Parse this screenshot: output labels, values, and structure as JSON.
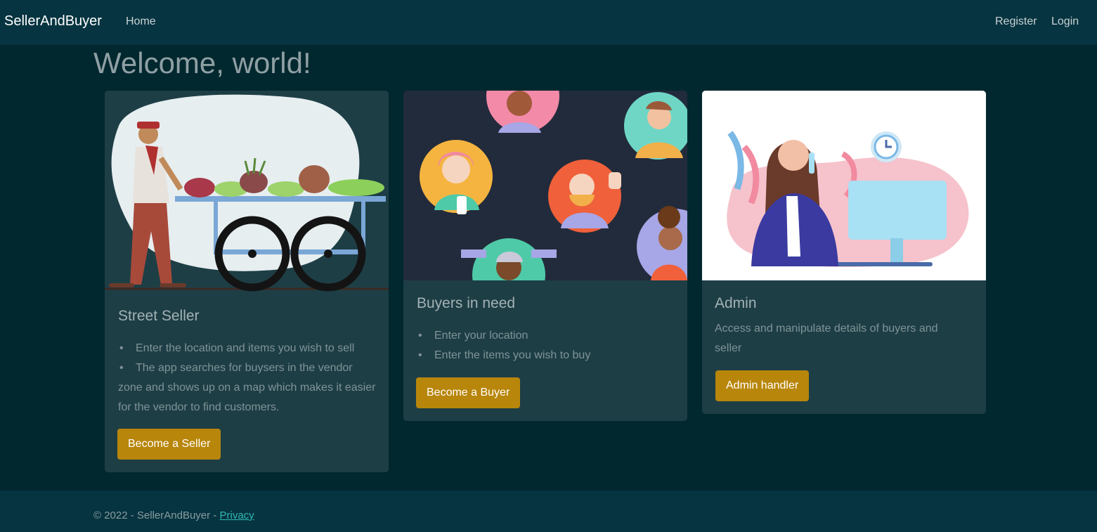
{
  "nav": {
    "brand": "SellerAndBuyer",
    "home": "Home",
    "register": "Register",
    "login": "Login"
  },
  "page": {
    "title": "Welcome, world!"
  },
  "cards": [
    {
      "title": "Street Seller",
      "items": [
        "Enter the location and items you wish to sell",
        "The app searches for buysers in the vendor zone and shows up on a map which makes it easier for the vendor to find customers."
      ],
      "button": "Become a Seller"
    },
    {
      "title": "Buyers in need",
      "items": [
        "Enter your location",
        "Enter the items you wish to buy"
      ],
      "button": "Become a Buyer"
    },
    {
      "title": "Admin",
      "description": "Access and manipulate details of buyers and seller",
      "button": "Admin handler"
    }
  ],
  "footer": {
    "copyright": "© 2022 - SellerAndBuyer - ",
    "privacy": "Privacy"
  },
  "colors": {
    "accent": "#b8860b",
    "navbar": "#063440",
    "background": "#02282f",
    "card": "#1e3e46"
  }
}
